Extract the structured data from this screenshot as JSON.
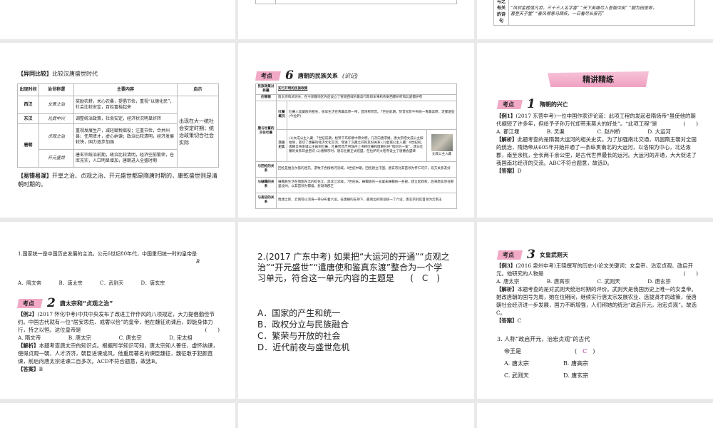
{
  "top_right": {
    "row_label": "与之有关的诗句",
    "row_text_1": "“风吹金榜落凡世，三十三人名字香” “天下英雄尽入吾彀中矣” “朝为田舍郎，",
    "row_text_2": "暮登天子堂” “春风得意马蹄疾，一日看尽长安花”"
  },
  "compare": {
    "title_tag": "【异同比较】",
    "title": "比较汉唐盛世时代",
    "headers": [
      "出现时间",
      "治世称谓",
      "主要内容",
      "启示"
    ],
    "rows": [
      {
        "era": "西汉",
        "name": "文景之治",
        "content": "奖励农耕，关心农桑，提倡节俭，重视“以德化民”，社会比较安定，百姓富裕起来"
      },
      {
        "era": "东汉",
        "name": "光武中兴",
        "content": "调整统治政策，社会安定，经济状况明显好转"
      },
      {
        "era": "唐朝",
        "name": "贞观之治",
        "content": "重视发展生产，减轻赋税徭役；注重节俭，合并州县；任用贤才，虚心纳谏；政治比较清明，经济发展较快，国力逐步加强"
      },
      {
        "name": "开元盛世",
        "content": "唐玄宗统治前期，政治比较清明，经济空前繁荣，仓库充实，人口明显增加，唐朝进入全盛时期"
      }
    ],
    "insight": "出现在大一统社会安定时期；统治政策切合社会实际",
    "mistake_tag": "【易错易混】",
    "mistake": "开皇之治、贞观之治、开元盛世都是隋唐时期的，康乾盛世则是清朝时期的。"
  },
  "ethnic": {
    "tag": "考点",
    "num": "6",
    "title": "唐朝的民族关系",
    "note": "(识记)",
    "r1_label": "民族政策对新疆",
    "r1_text": "实行开明的民族政策",
    "r2_label": "的管辖",
    "r2_text": "唐太宗和武则天，在今新疆地区先后设立了管辖西域的最高行政和军事机构安西都护府和北庭都护府",
    "tibet_label": "唐与吐蕃的交往吐蕃",
    "tibet_sub1": "吐蕃概况",
    "tibet_text1": "吐蕃人是藏族的祖先，很早生活在青藏高原一带，首领称赞普。7世纪前期，赞普松赞干布统一青藏高原，定都逻些(今拉萨)",
    "tibet_sub2": "交往史实",
    "tibet_text2": "(1)文成公主入藏：7世纪前期，松赞干布仰慕中原文明，几次向唐求婚，唐太宗把文成公主嫁给他，密切了唐蕃的经济文化交流，增进了汉藏之间的友好关系 (2)金城公主入藏：8世纪初，唐朝又将金城公主嫁到吐蕃，吐蕃赞普尺带珠丹上书称吐蕃和唐朝已经“和同为一家”，唐与吐蕃的关系日益密切 (2)唐穆宗时，唐与吐蕃正式结盟，在拉萨的大昭寺设立了唐蕃会盟碑",
    "img_caption": "文成公主入藏",
    "r4_label": "与回纥的关系",
    "r4_text": "回纥是维吾尔族的祖先，游牧于色楞格河流域。8世纪中期，回纥建立汗国，唐玄宗封其首领为怀仁可汗，双方关系友好",
    "r5_label": "与靺鞨的关系",
    "r5_text": "靺鞨族生活在我国东北的松花江、黑龙江流域。7世纪末，靺鞨族的一支粟末靺鞨统一各部，建立起政权，后来唐玄宗在那里设州，以其首领为都督，封渤海郡王",
    "r6_label": "与南诏的关系",
    "r6_text": "隋唐之际，云南苍山洱海一带分布着六诏。在唐朝的支持下，最南边的南诏统一了六诏，唐玄宗封其首领为云南王"
  },
  "practice": {
    "banner": "精讲精练",
    "tag": "考点",
    "num": "1",
    "title": "隋朝的兴亡",
    "ex_label": "【例1】",
    "ex_source": "(2017 东营中考)",
    "ex_text": "一位中国作家评论道：此项工程的发起者隋炀帝“虽使他的朝代缩短了许多年，但给予子孙万代却带来莫大的好处”。“此项工程”是",
    "bracket": "(　　)",
    "options": [
      "A. 都江堰",
      "B. 灵渠",
      "C. 赵州桥",
      "D. 大运河"
    ],
    "analysis_label": "【解析】",
    "analysis": "此题考查的是隋朝大运河的相关史实。为了加强南北交通，巩固隋王朝对全国的统治，隋炀帝从605年开始开通了一条纵贯南北的大运河，以洛阳为中心，北达涿郡，南至余杭，全长两千余公里，是古代世界最长的运河。大运河的开通，大大促进了我国南北经济的交流。ABC不符合题意，故选D。",
    "answer_label": "【答案】",
    "answer": "D"
  },
  "q1": {
    "text": "1.国家统一是中国历史发展的主流。公元6世纪80年代，中国重归统一时的皇帝是",
    "answer": "B",
    "options": [
      "A．隋文帝",
      "B．唐太宗",
      "C．武则天",
      "D．唐玄宗"
    ],
    "tag": "考点",
    "num": "2",
    "title": "唐太宗和“贞观之治”",
    "ex_label": "【例2】",
    "ex_source": "(2017 怀化中考)",
    "ex_text": "中共中央发布了改进工作作风的八项规定，大力提倡勤俭节约。中国古代就有一位“居安思危、戒奢以俭”的皇帝，他在魏征劝谏后，即能身体力行，持之以恒。这位皇帝是",
    "bracket": "(　　)",
    "ex_options": [
      "A. 隋文帝",
      "B. 唐太宗",
      "C. 唐玄宗",
      "D. 宋太祖"
    ],
    "analysis_label": "【解析】",
    "analysis": "本题考查唐太宗的知识点。根据所学知识可知，唐太宗知人善任，虚怀纳谏，使得贞观一朝，人才济济，朝臣进谏成风，他重用著名的谏臣魏征，魏征敢于犯颜直谏，前后向唐太宗进谏二百多次。ACD不符合题意，故选B。",
    "answer_label": "【答案】"
  },
  "q2": {
    "text": "2.(2017 广东中考) 如果把“大运河的开通”“贞观之治”“开元盛世”“遣唐使和鉴真东渡”整合为一个学习单元，符合这一单元内容的主题是",
    "answer": "(　C　)",
    "options": [
      "A．国家的产生和统一",
      "B．政权分立与民族融合",
      "C．繁荣与开放的社会",
      "D．近代前夜与盛世危机"
    ]
  },
  "q3": {
    "tag": "考点",
    "num": "3",
    "title": "女皇武则天",
    "ex_label": "【例3】",
    "ex_source": "(2016 泉州中考)",
    "ex_text": "王晓撰写的历史小论文关键词：女皇帝、治宏贞观、政启开元。他研究的人物是",
    "bracket": "(　　)",
    "ex_options": [
      "A. 唐太宗",
      "B. 唐高宗",
      "C. 武则天",
      "D. 唐玄宗"
    ],
    "analysis_label": "【解析】",
    "analysis": "本题考查的是对武则天统治时期的评价。武则天是我国历史上唯一的女皇帝。她改唐朝的国号为周，她在位期间，继续实行唐太宗发展农业、选拔贤才的政策，使唐朝社会经济进一步发展，国力不断增强，人们称她的统治“政启开元，治宏贞观”。故选C。",
    "answer_label": "【答案】",
    "answer": "C",
    "q_text_1": "3. 人称“政启开元，治宏贞观”的古代",
    "q_text_2": "帝王是",
    "q_answer": "C",
    "q_options": [
      "A. 唐太宗",
      "B. 唐高宗",
      "C. 武则天",
      "D. 唐玄宗"
    ]
  },
  "colors": {
    "pink": "#f2a9c6",
    "answer": "#a0338a",
    "gap": "#e9e9e9"
  }
}
